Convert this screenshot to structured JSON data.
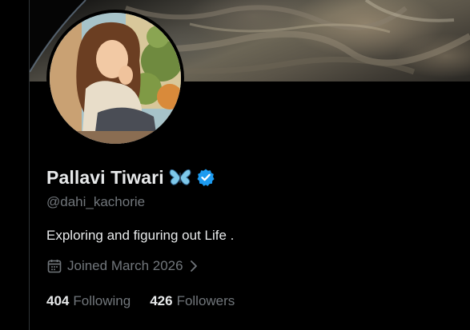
{
  "profile": {
    "display_name": "Pallavi Tiwari",
    "handle": "@dahi_kachorie",
    "bio": "Exploring and figuring out Life .",
    "joined": "Joined March 2026",
    "following_count": "404",
    "following_label": "Following",
    "followers_count": "426",
    "followers_label": "Followers"
  },
  "icons": {
    "name_emoji": "butterfly-icon",
    "verified": "verified-badge-icon",
    "calendar": "calendar-icon",
    "joined_chevron": "chevron-right-icon"
  },
  "colors": {
    "background": "#000000",
    "primary_text": "#e7e9ea",
    "secondary_text": "#71767b",
    "verified_blue": "#1d9bf0",
    "border": "#2f3336"
  }
}
